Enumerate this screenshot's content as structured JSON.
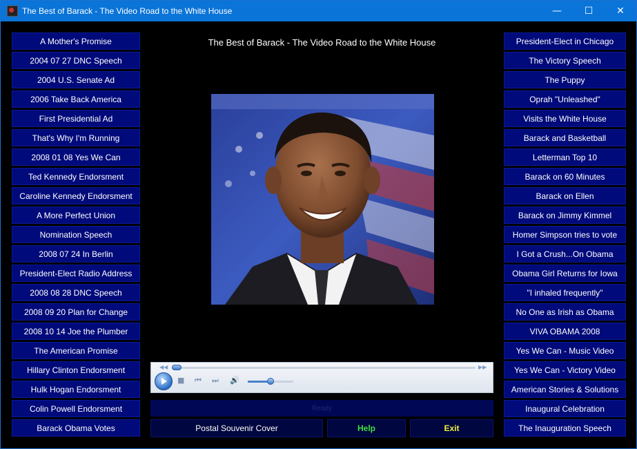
{
  "window": {
    "title": "The Best of Barack - The Video Road to the White House",
    "minimize_glyph": "—",
    "maximize_glyph": "☐",
    "close_glyph": "✕"
  },
  "main": {
    "video_title": "The Best of Barack - The Video Road to the White House",
    "status_text": "Ready"
  },
  "left_list": [
    "A Mother's Promise",
    "2004 07 27 DNC Speech",
    "2004 U.S. Senate Ad",
    "2006 Take Back America",
    "First Presidential Ad",
    "That's Why I'm Running",
    "2008 01 08  Yes We Can",
    "Ted Kennedy Endorsment",
    "Caroline Kennedy Endorsment",
    "A More Perfect Union",
    "Nomination Speech",
    "2008 07 24  In Berlin",
    "President-Elect Radio Address",
    "2008 08 28 DNC Speech",
    "2008 09 20 Plan for Change",
    "2008 10 14 Joe the Plumber",
    "The American Promise",
    "Hillary Clinton Endorsment",
    "Hulk Hogan Endorsment",
    "Colin Powell Endorsment",
    "Barack Obama Votes"
  ],
  "right_list": [
    "President-Elect in Chicago",
    "The Victory Speech",
    "The Puppy",
    "Oprah \"Unleashed\"",
    "Visits the White House",
    "Barack and Basketball",
    "Letterman Top 10",
    "Barack on 60 Minutes",
    "Barack on Ellen",
    "Barack on Jimmy Kimmel",
    "Homer Simpson tries to vote",
    "I Got a Crush...On Obama",
    "Obama Girl Returns for Iowa",
    "\"I inhaled frequently\"",
    "No One as Irish as Obama",
    "VIVA OBAMA 2008",
    "Yes We Can - Music Video",
    "Yes We Can - Victory Video",
    "American Stories & Solutions",
    "Inaugural Celebration",
    "The Inauguration Speech"
  ],
  "player": {
    "seek_position": 0.0,
    "volume_level": 0.5
  },
  "bottom_buttons": {
    "postal": "Postal Souvenir Cover",
    "help": "Help",
    "exit": "Exit"
  },
  "colors": {
    "list_button_bg": "#000a7a",
    "titlebar": "#0a74d8",
    "help_text": "#40e040",
    "exit_text": "#f0f040"
  }
}
